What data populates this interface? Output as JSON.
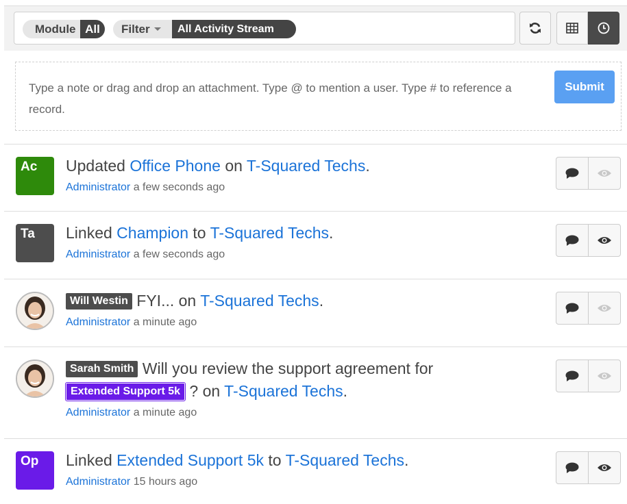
{
  "toolbar": {
    "module_label": "Module",
    "module_value": "All",
    "filter_label": "Filter",
    "filter_value": "All Activity Stream"
  },
  "compose": {
    "placeholder": "Type a note or drag and drop an attachment. Type @ to mention a user. Type # to reference a record.",
    "submit_label": "Submit",
    "submit_color": "#5aa0f2"
  },
  "activities": [
    {
      "avatar_text": "Ac",
      "avatar_color": "#2e8a0b",
      "verb": "Updated",
      "object": "Office Phone",
      "prep": "on",
      "record": "T-Squared Techs",
      "end": ".",
      "author": "Administrator",
      "time": "a few seconds ago"
    },
    {
      "avatar_text": "Ta",
      "avatar_color": "#4d4d4d",
      "verb": "Linked",
      "object": "Champion",
      "prep": "to",
      "record": "T-Squared Techs",
      "end": ".",
      "author": "Administrator",
      "time": "a few seconds ago"
    },
    {
      "user_tag": "Will Westin",
      "message": "FYI... on",
      "record": "T-Squared Techs",
      "end": ".",
      "author": "Administrator",
      "time": "a minute ago"
    },
    {
      "user_tag": "Sarah Smith",
      "message": "Will you review the support agreement for",
      "record_tag": "Extended Support 5k",
      "message2": "? on",
      "record": "T-Squared Techs",
      "end": ".",
      "author": "Administrator",
      "time": "a minute ago"
    },
    {
      "avatar_text": "Op",
      "avatar_color": "#6a1be8",
      "verb": "Linked",
      "object": "Extended Support 5k",
      "prep": "to",
      "record": "T-Squared Techs",
      "end": ".",
      "author": "Administrator",
      "time": "15 hours ago"
    }
  ],
  "icons": {
    "refresh": "refresh-icon",
    "table": "table-view-icon",
    "clock": "clock-icon",
    "comment": "comment-icon",
    "preview": "eye-icon"
  }
}
